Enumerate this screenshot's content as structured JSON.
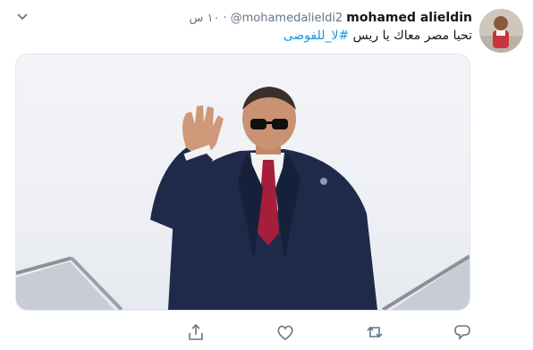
{
  "tweet": {
    "author_name": "mohamed alieldin",
    "author_handle": "@mohamedalieldi2",
    "separator": "·",
    "time": "١٠ س",
    "text": "تحيا مصر معاك يا ريس ",
    "hashtag": "#لا_للفوضى"
  },
  "icons": {
    "more": "chevron-down-icon",
    "share": "share-icon",
    "like": "heart-icon",
    "retweet": "retweet-icon",
    "reply": "reply-icon"
  },
  "colors": {
    "hashtag": "#1b95e0",
    "muted": "#657786",
    "text": "#14171a"
  }
}
